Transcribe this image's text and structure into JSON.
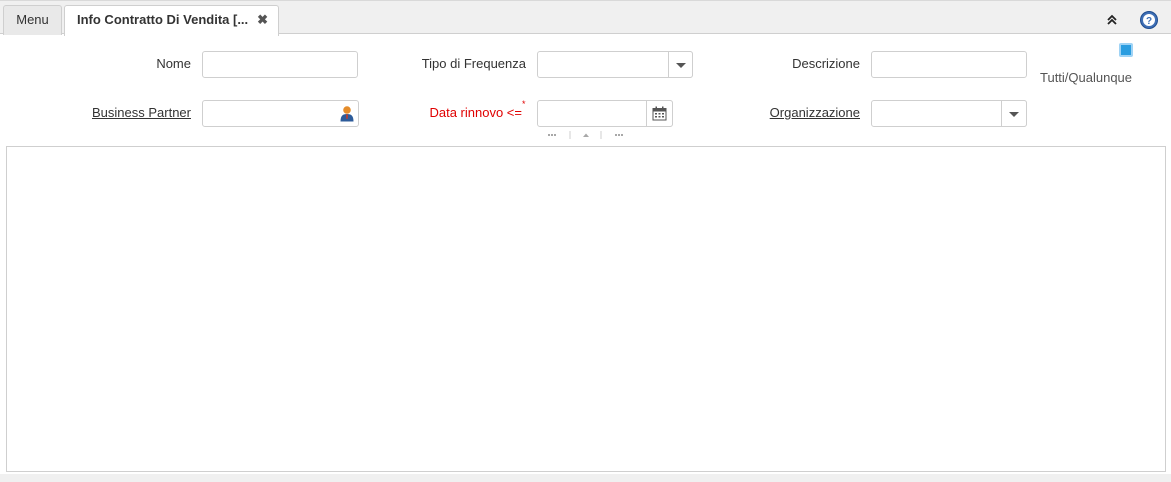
{
  "tabs": {
    "menu_label": "Menu",
    "active_label": "Info Contratto Di Vendita [...",
    "close_glyph": "✖"
  },
  "header_icons": {
    "collapse": "double-chevron-up-icon",
    "help": "question-circle-icon"
  },
  "form": {
    "nome": {
      "label": "Nome",
      "value": ""
    },
    "tipo_frequenza": {
      "label": "Tipo di Frequenza",
      "value": ""
    },
    "descrizione": {
      "label": "Descrizione",
      "value": ""
    },
    "tutti_qualunque": {
      "label": "Tutti/Qualunque",
      "checked": true
    },
    "business_partner": {
      "label": "Business Partner",
      "value": ""
    },
    "data_rinnovo": {
      "label": "Data rinnovo <=",
      "required_mark": "*",
      "value": ""
    },
    "organizzazione": {
      "label": "Organizzazione",
      "value": ""
    }
  },
  "colors": {
    "required_label": "#e00000",
    "checkbox": "#2a9de0",
    "border": "#cfcfcf"
  }
}
